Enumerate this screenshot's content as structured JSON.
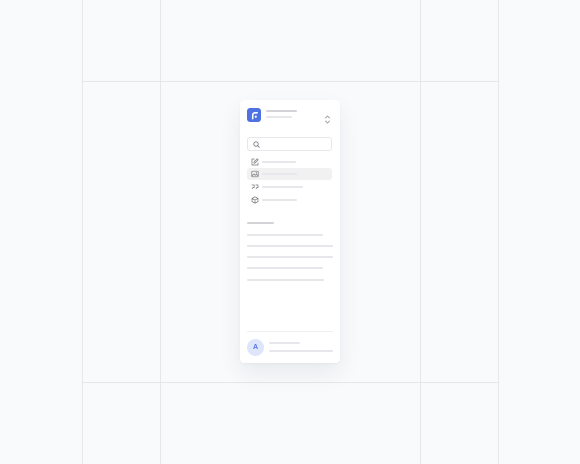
{
  "user": {
    "avatar_initial": "A"
  },
  "icons": {
    "logo": "app-logo-icon",
    "switcher": "chevron-up-down-icon",
    "search": "search-icon",
    "nav": [
      "edit-icon",
      "image-icon",
      "quote-icon",
      "cube-icon"
    ]
  },
  "colors": {
    "accent": "#4f72e3",
    "avatar_bg": "#dfe6fb",
    "active_item_bg": "#f1f1f2",
    "skeleton": "#e5e7eb",
    "background": "#f8fafc"
  }
}
